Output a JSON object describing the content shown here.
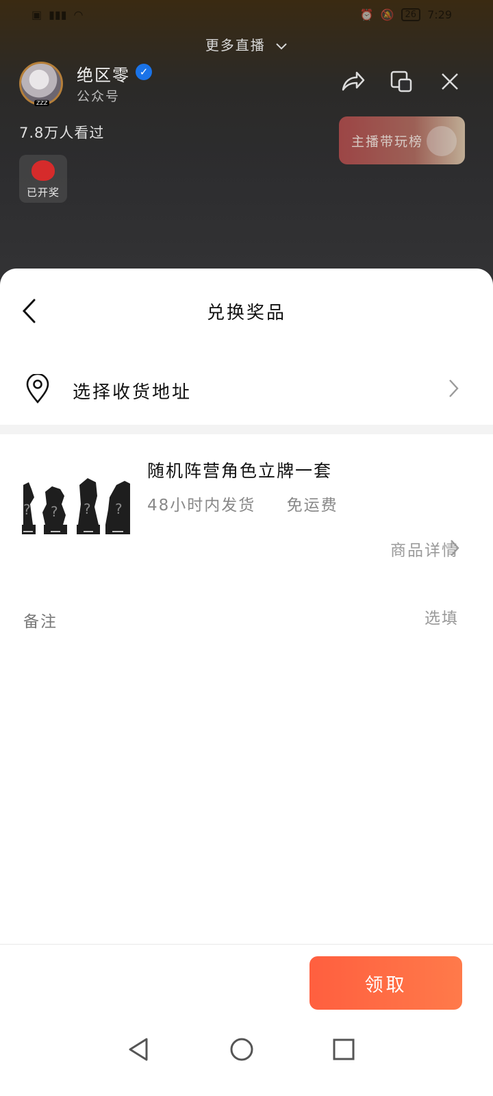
{
  "status_bar": {
    "left_icons": [
      "hd-icon",
      "signal-icon",
      "wifi-icon"
    ],
    "right_icons": [
      "alarm-icon",
      "mute-icon"
    ],
    "battery": "26",
    "time": "7:29"
  },
  "live": {
    "more_live": "更多直播",
    "streamer_name": "绝区零",
    "streamer_sub": "公众号",
    "avatar_badge": "ZZZ",
    "viewers": "7.8万人看过",
    "rank_button": "主播带玩榜",
    "lottery_label": "已开奖"
  },
  "sheet": {
    "title": "兑换奖品",
    "address_label": "选择收货地址",
    "product": {
      "title": "随机阵营角色立牌一套",
      "shipping": "48小时内发货",
      "fee": "免运费",
      "detail_link": "商品详情"
    },
    "remark_label": "备注",
    "remark_placeholder": "选填",
    "claim_button": "领取"
  },
  "colors": {
    "accent": "#ff6a45",
    "verified": "#1a73e8"
  }
}
